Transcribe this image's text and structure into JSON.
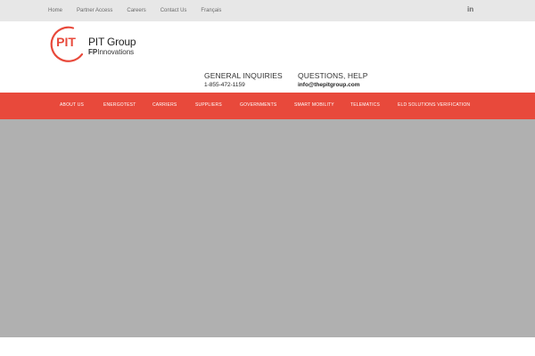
{
  "topnav": {
    "items": [
      "Home",
      "Partner Access",
      "Careers",
      "Contact Us",
      "Français"
    ],
    "social_icon": "linkedin-icon",
    "social_text": "in"
  },
  "logo": {
    "mark": "PIT",
    "title": "PIT Group",
    "sub_bold": "FP",
    "sub_rest": "Innovations",
    "color": "#e8493b"
  },
  "contact": {
    "general": {
      "heading": "GENERAL INQUIRIES",
      "value": "1-855-472-1159"
    },
    "questions": {
      "heading": "QUESTIONS, HELP",
      "value": "info@thepitgroup.com"
    }
  },
  "mainnav": {
    "items": [
      "ABOUT US",
      "ENERGOTEST",
      "CARRIERS",
      "SUPPLIERS",
      "GOVERNMENTS",
      "SMART MOBILITY",
      "TELEMATICS",
      "ELD SOLUTIONS VERIFICATION"
    ],
    "color": "#e8493b"
  },
  "colors": {
    "topbar": "#e7e7e7",
    "hero": "#b0b0b0"
  }
}
